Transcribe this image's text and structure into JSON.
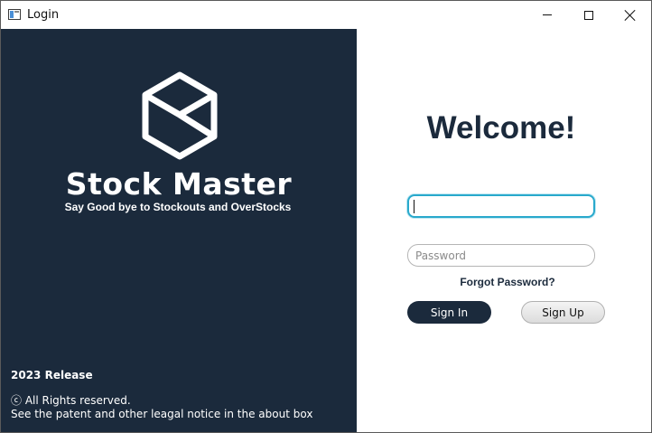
{
  "window": {
    "title": "Login",
    "icon": "app-window-icon",
    "controls": {
      "minimize": "minimize-icon",
      "maximize": "maximize-icon",
      "close": "close-icon"
    }
  },
  "brand": {
    "logo_icon": "cube-logo-icon",
    "name": "Stock Master",
    "tagline": "Say Good bye to Stockouts and OverStocks"
  },
  "footer": {
    "release": "2023 Release",
    "rights": "ⓒ All Rights reserved.",
    "notice": "See the patent and other leagal notice in the about box"
  },
  "login": {
    "heading": "Welcome!",
    "username": {
      "value": "",
      "placeholder": ""
    },
    "password": {
      "value": "",
      "placeholder": "Password"
    },
    "forgot_label": "Forgot Password?",
    "signin_label": "Sign In",
    "signup_label": "Sign Up"
  },
  "colors": {
    "panel_dark": "#1b2a3c",
    "focus_border": "#29a9cc",
    "text_light": "#ffffff"
  }
}
